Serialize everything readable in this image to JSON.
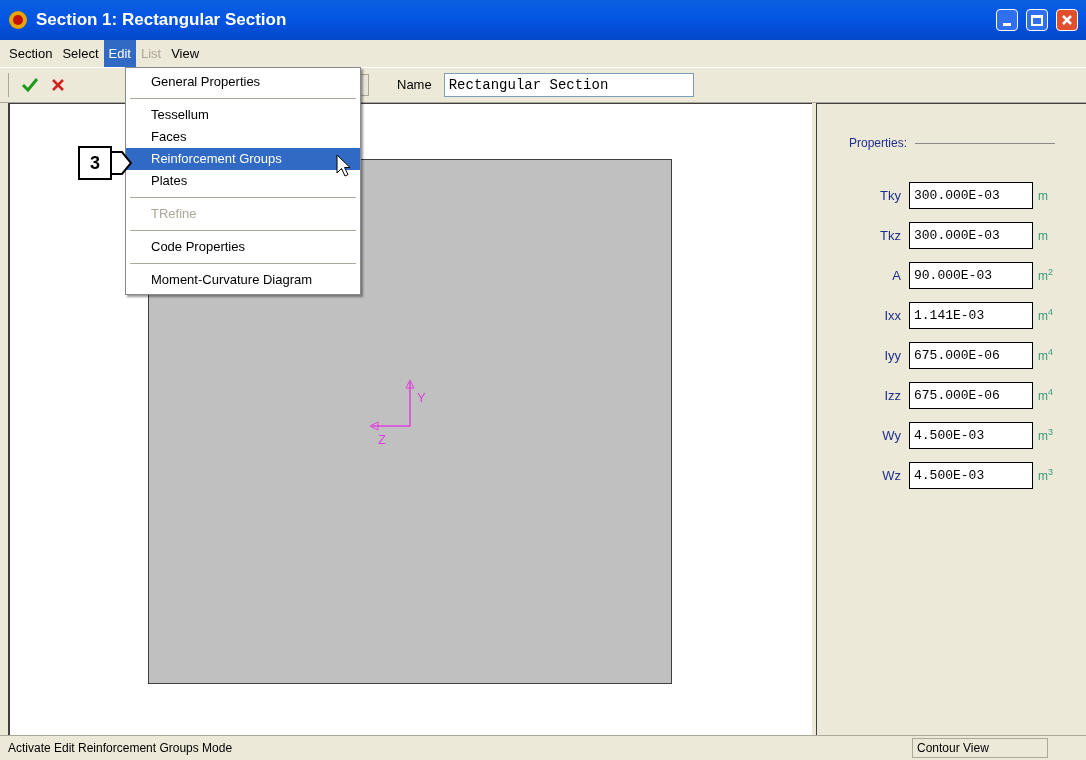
{
  "window": {
    "title": "Section 1: Rectangular Section"
  },
  "menubar": [
    {
      "label": "Section",
      "selected": false,
      "disabled": false
    },
    {
      "label": "Select",
      "selected": false,
      "disabled": false
    },
    {
      "label": "Edit",
      "selected": true,
      "disabled": false
    },
    {
      "label": "List",
      "selected": false,
      "disabled": true
    },
    {
      "label": "View",
      "selected": false,
      "disabled": false
    }
  ],
  "edit_menu": [
    {
      "kind": "item",
      "label": "General Properties",
      "selected": false,
      "disabled": false
    },
    {
      "kind": "separator"
    },
    {
      "kind": "item",
      "label": "Tessellum",
      "selected": false,
      "disabled": false
    },
    {
      "kind": "item",
      "label": "Faces",
      "selected": false,
      "disabled": false
    },
    {
      "kind": "item",
      "label": "Reinforcement Groups",
      "selected": true,
      "disabled": false
    },
    {
      "kind": "item",
      "label": "Plates",
      "selected": false,
      "disabled": false
    },
    {
      "kind": "separator"
    },
    {
      "kind": "item",
      "label": "TRefine",
      "selected": false,
      "disabled": true
    },
    {
      "kind": "separator"
    },
    {
      "kind": "item",
      "label": "Code Properties",
      "selected": false,
      "disabled": false
    },
    {
      "kind": "separator"
    },
    {
      "kind": "item",
      "label": "Moment-Curvature Diagram",
      "selected": false,
      "disabled": false
    }
  ],
  "toolbar": {
    "name_label": "Name",
    "name_value": "Rectangular Section"
  },
  "callout": {
    "label": "3"
  },
  "canvas": {
    "axes": {
      "y_label": "Y",
      "z_label": "Z"
    }
  },
  "properties": {
    "title": "Properties:",
    "rows": [
      {
        "label": "Tky",
        "value": "300.000E-03",
        "unit": "m"
      },
      {
        "label": "Tkz",
        "value": "300.000E-03",
        "unit": "m"
      },
      {
        "label": "A",
        "value": "90.000E-03",
        "unit": "m$^{2}$"
      },
      {
        "label": "Ixx",
        "value": "1.141E-03",
        "unit": "m$^{4}$"
      },
      {
        "label": "Iyy",
        "value": "675.000E-06",
        "unit": "m$^{4}$"
      },
      {
        "label": "Izz",
        "value": "675.000E-06",
        "unit": "m$^{4}$"
      },
      {
        "label": "Wy",
        "value": "4.500E-03",
        "unit": "m$^{3}$"
      },
      {
        "label": "Wz",
        "value": "4.500E-03",
        "unit": "m$^{3}$"
      }
    ]
  },
  "status_bar": {
    "message": "Activate Edit Reinforcement Groups Mode",
    "view": "Contour View"
  }
}
